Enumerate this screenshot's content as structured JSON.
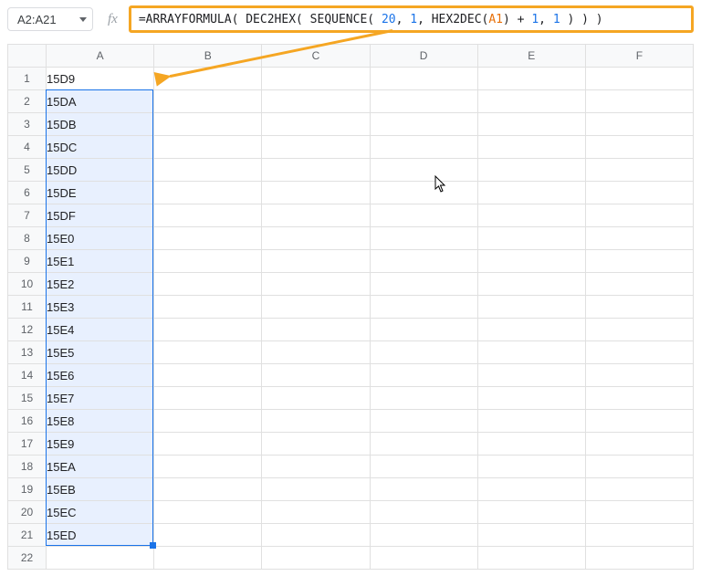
{
  "name_box": {
    "value": "A2:A21"
  },
  "fx_label": "fx",
  "formula": {
    "tokens": [
      {
        "t": "=ARRAYFORMULA( DEC2HEX( SEQUENCE( ",
        "c": "tok-black"
      },
      {
        "t": "20",
        "c": "tok-num"
      },
      {
        "t": ", ",
        "c": "tok-black"
      },
      {
        "t": "1",
        "c": "tok-num"
      },
      {
        "t": ", HEX2DEC(",
        "c": "tok-black"
      },
      {
        "t": "A1",
        "c": "tok-ref"
      },
      {
        "t": ") + ",
        "c": "tok-black"
      },
      {
        "t": "1",
        "c": "tok-num"
      },
      {
        "t": ", ",
        "c": "tok-black"
      },
      {
        "t": "1",
        "c": "tok-num"
      },
      {
        "t": " ) ) )",
        "c": "tok-black"
      }
    ]
  },
  "columns": [
    "A",
    "B",
    "C",
    "D",
    "E",
    "F"
  ],
  "rows": [
    {
      "n": 1,
      "a": "15D9"
    },
    {
      "n": 2,
      "a": "15DA"
    },
    {
      "n": 3,
      "a": "15DB"
    },
    {
      "n": 4,
      "a": "15DC"
    },
    {
      "n": 5,
      "a": "15DD"
    },
    {
      "n": 6,
      "a": "15DE"
    },
    {
      "n": 7,
      "a": "15DF"
    },
    {
      "n": 8,
      "a": "15E0"
    },
    {
      "n": 9,
      "a": "15E1"
    },
    {
      "n": 10,
      "a": "15E2"
    },
    {
      "n": 11,
      "a": "15E3"
    },
    {
      "n": 12,
      "a": "15E4"
    },
    {
      "n": 13,
      "a": "15E5"
    },
    {
      "n": 14,
      "a": "15E6"
    },
    {
      "n": 15,
      "a": "15E7"
    },
    {
      "n": 16,
      "a": "15E8"
    },
    {
      "n": 17,
      "a": "15E9"
    },
    {
      "n": 18,
      "a": "15EA"
    },
    {
      "n": 19,
      "a": "15EB"
    },
    {
      "n": 20,
      "a": "15EC"
    },
    {
      "n": 21,
      "a": "15ED"
    },
    {
      "n": 22,
      "a": ""
    }
  ],
  "selection": {
    "col": "A",
    "row_start": 2,
    "row_end": 21
  }
}
